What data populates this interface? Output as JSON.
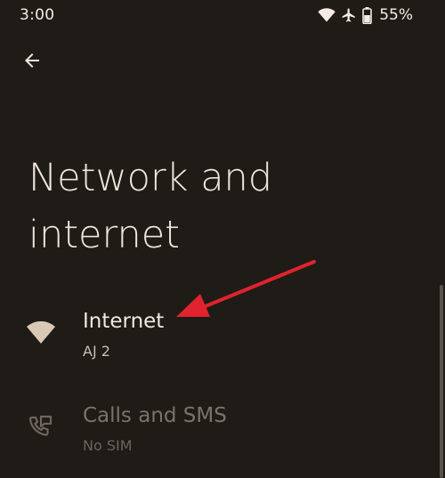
{
  "status_bar": {
    "time": "3:00",
    "battery_percent": "55%",
    "icons": [
      "wifi-icon",
      "airplane-icon",
      "battery-icon"
    ]
  },
  "header": {
    "back_icon": "arrow-left-icon",
    "title": "Network and internet"
  },
  "items": [
    {
      "icon": "wifi-icon",
      "title": "Internet",
      "subtitle": "AJ 2",
      "enabled": true
    },
    {
      "icon": "calls-sms-icon",
      "title": "Calls and SMS",
      "subtitle": "No SIM",
      "enabled": false
    }
  ],
  "colors": {
    "background": "#1f1b17",
    "text_primary": "#f1e8de",
    "text_secondary": "#c9beb2",
    "icon_tint": "#d9c8b6",
    "annotation_arrow": "#e0232e"
  }
}
